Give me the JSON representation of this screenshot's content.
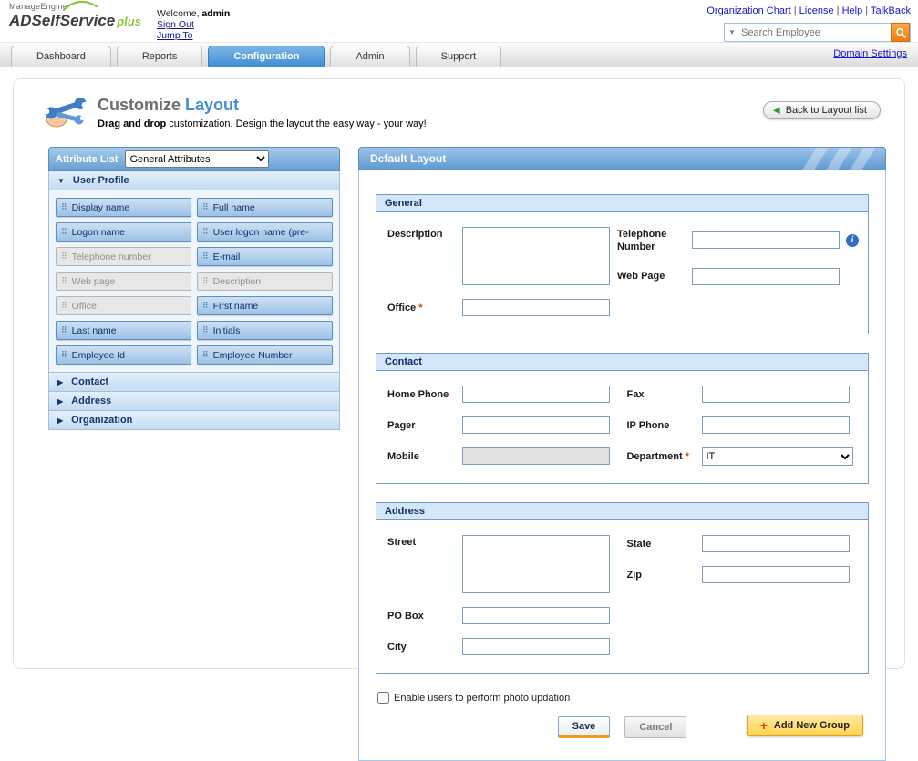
{
  "header": {
    "brand_top": "ManageEngine",
    "brand_main": "ADSelfService",
    "brand_plus": "plus",
    "welcome": "Welcome,",
    "username": "admin",
    "sign_out": "Sign Out",
    "jump_to": "Jump To",
    "links": [
      "Organization Chart",
      "License",
      "Help",
      "TalkBack"
    ],
    "search": {
      "placeholder": "Search Employee"
    }
  },
  "nav": {
    "tabs": [
      {
        "label": "Dashboard",
        "active": false
      },
      {
        "label": "Reports",
        "active": false
      },
      {
        "label": "Configuration",
        "active": true
      },
      {
        "label": "Admin",
        "active": false
      },
      {
        "label": "Support",
        "active": false
      }
    ],
    "domain_settings": "Domain Settings"
  },
  "page": {
    "title_primary": "Customize",
    "title_accent": "Layout",
    "subtitle_bold": "Drag and drop",
    "subtitle_rest": " customization. Design the layout the easy way - your way!",
    "back_button": "Back to Layout list"
  },
  "attribute_panel": {
    "title": "Attribute List",
    "category": "General Attributes",
    "sections": [
      {
        "label": "User Profile",
        "expanded": true
      },
      {
        "label": "Contact",
        "expanded": false
      },
      {
        "label": "Address",
        "expanded": false
      },
      {
        "label": "Organization",
        "expanded": false
      }
    ],
    "items": [
      {
        "label": "Display name",
        "enabled": true
      },
      {
        "label": "Full name",
        "enabled": true
      },
      {
        "label": "Logon name",
        "enabled": true
      },
      {
        "label": "User logon name (pre-",
        "enabled": true
      },
      {
        "label": "Telephone number",
        "enabled": false
      },
      {
        "label": "E-mail",
        "enabled": true
      },
      {
        "label": "Web page",
        "enabled": false
      },
      {
        "label": "Description",
        "enabled": false
      },
      {
        "label": "Office",
        "enabled": false
      },
      {
        "label": "First name",
        "enabled": true
      },
      {
        "label": "Last name",
        "enabled": true
      },
      {
        "label": "Initials",
        "enabled": true
      },
      {
        "label": "Employee Id",
        "enabled": true
      },
      {
        "label": "Employee Number",
        "enabled": true
      }
    ]
  },
  "layout_panel": {
    "title": "Default Layout",
    "groups": [
      {
        "name": "General",
        "left": [
          {
            "label": "Description",
            "type": "textarea"
          },
          {
            "label": "Office",
            "type": "input",
            "required": true
          }
        ],
        "right": [
          {
            "label": "Telephone Number",
            "type": "input",
            "info": true
          },
          {
            "label": "Web Page",
            "type": "input"
          }
        ]
      },
      {
        "name": "Contact",
        "left": [
          {
            "label": "Home Phone",
            "type": "input"
          },
          {
            "label": "Pager",
            "type": "input"
          },
          {
            "label": "Mobile",
            "type": "input",
            "disabled": true
          }
        ],
        "right": [
          {
            "label": "Fax",
            "type": "input"
          },
          {
            "label": "IP Phone",
            "type": "input"
          },
          {
            "label": "Department",
            "type": "select",
            "required": true,
            "value": "IT"
          }
        ]
      },
      {
        "name": "Address",
        "left": [
          {
            "label": "Street",
            "type": "textarea"
          },
          {
            "label": "PO Box",
            "type": "input"
          },
          {
            "label": "City",
            "type": "input"
          }
        ],
        "right": [
          {
            "label": "State",
            "type": "input"
          },
          {
            "label": "Zip",
            "type": "input"
          }
        ]
      }
    ],
    "photo_checkbox_label": "Enable users to perform photo updation",
    "save_label": "Save",
    "cancel_label": "Cancel",
    "add_group_label": "Add New Group"
  },
  "icons": {
    "collapse_glyph": "▼",
    "expand_glyph": "▶",
    "drag_handle_glyph": "⠿",
    "back_arrow_glyph": "◀",
    "search_dropdown_glyph": "▾",
    "info_glyph": "i",
    "plus_glyph": "+",
    "separator_glyph": " | "
  },
  "colors": {
    "tab_active": "#3f8ed6",
    "panel_header": "#679fd2",
    "link": "#1414cc",
    "group_header_bg": "#d4e6f8",
    "item_enabled": "#9cc2e7",
    "item_disabled": "#e7e7e7",
    "add_group_bg": "#ffd24e",
    "save_accent": "#f29a1e",
    "required": "#d24000",
    "brand_green": "#8cc63f"
  }
}
